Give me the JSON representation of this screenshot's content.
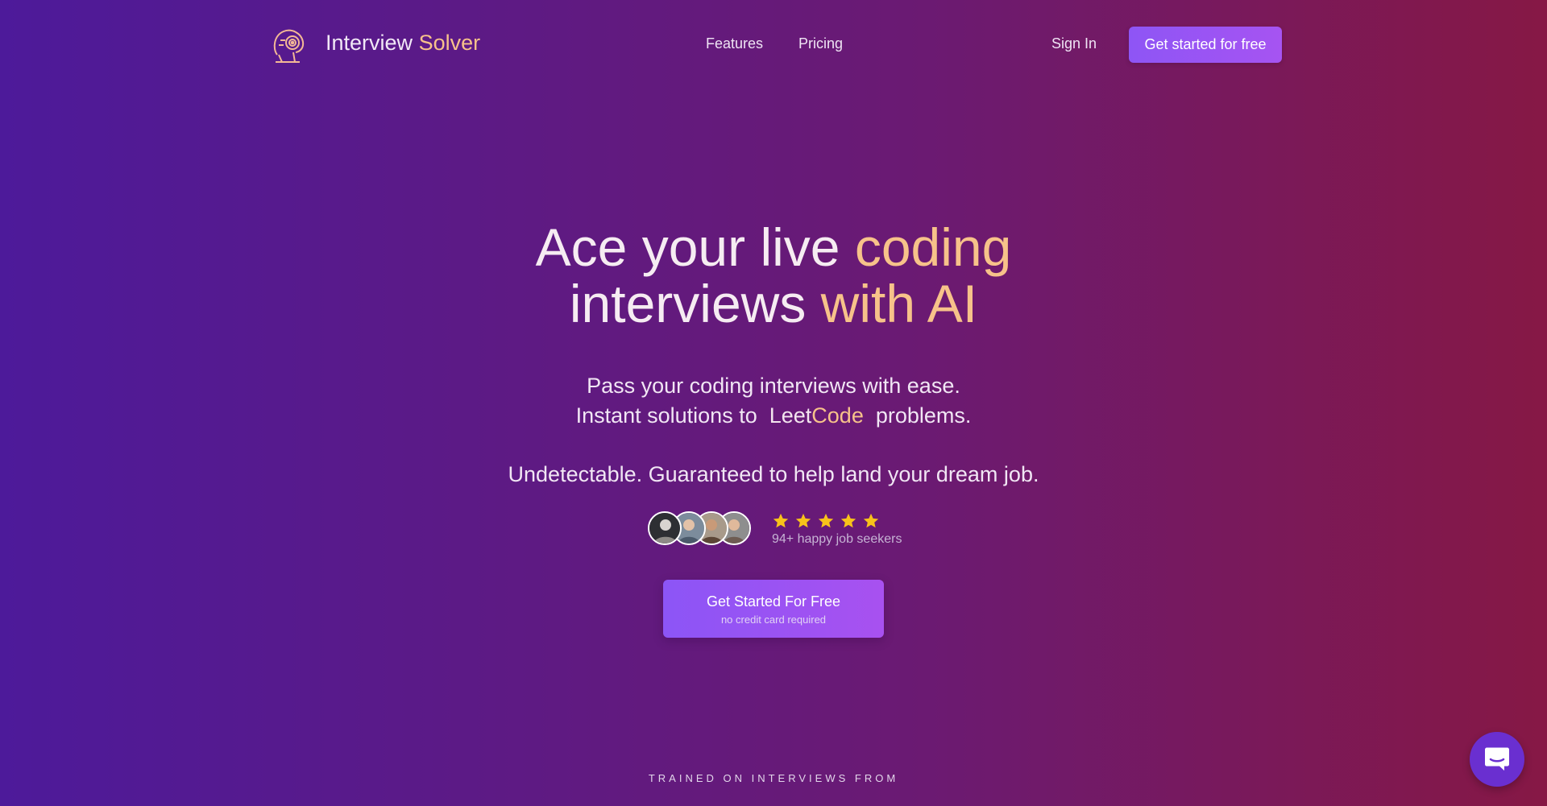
{
  "header": {
    "brand_main": "Interview",
    "brand_accent": "Solver",
    "logo_icon": "robot-head-icon",
    "nav": {
      "features": "Features",
      "pricing": "Pricing"
    },
    "sign_in": "Sign In",
    "cta": "Get started for free"
  },
  "hero": {
    "title_part1": "Ace your live",
    "title_part2": "coding",
    "title_part3": "interviews",
    "title_part4": "with AI",
    "sub1": "Pass your coding interviews with ease.",
    "sub2_prefix": "Instant solutions to",
    "sub2_leet": "Leet",
    "sub2_code": "Code",
    "sub2_suffix": "problems.",
    "sub3": "Undetectable. Guaranteed to help land your dream job."
  },
  "social_proof": {
    "rating_stars": 5,
    "rating_text": "94+ happy job seekers"
  },
  "main_cta": {
    "label": "Get Started For Free",
    "sublabel": "no credit card required"
  },
  "trained": "TRAINED ON INTERVIEWS FROM",
  "chat": {
    "icon": "chat-bubble-icon"
  },
  "colors": {
    "accent": "#f7c28a",
    "button": "#9a55f4",
    "star": "#f8c21a"
  }
}
